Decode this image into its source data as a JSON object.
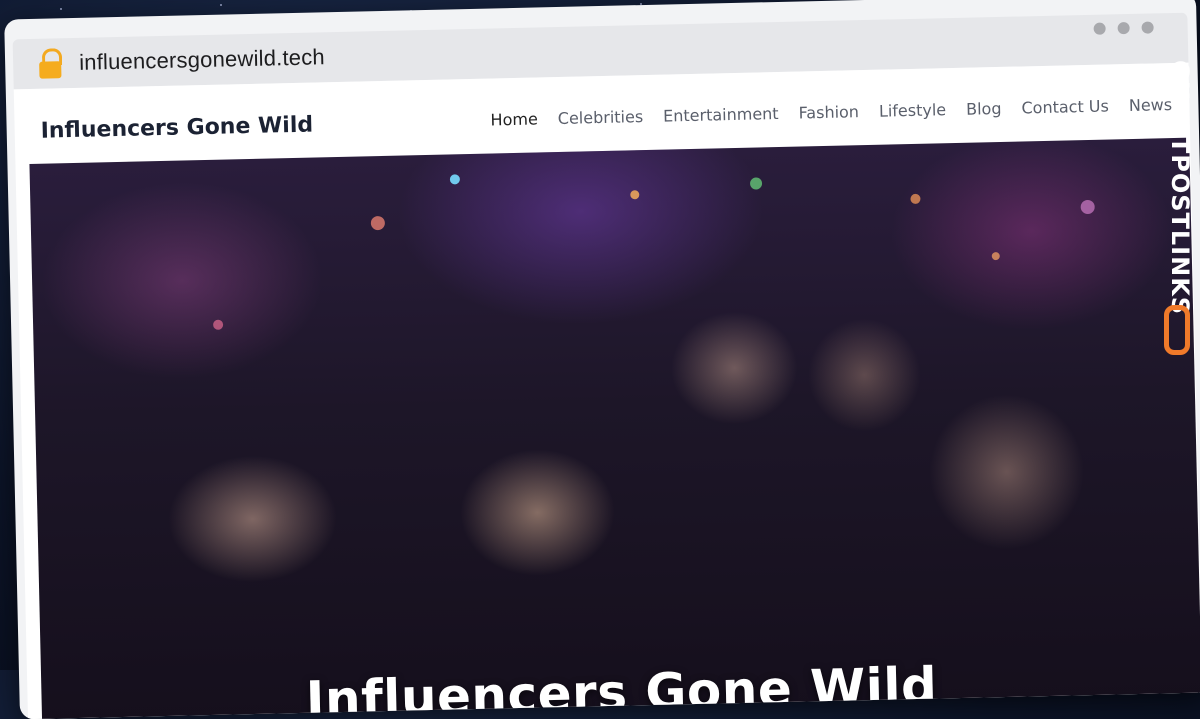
{
  "browser": {
    "url": "influencersgonewild.tech",
    "lock_icon": "lock-icon"
  },
  "site": {
    "title": "Influencers Gone Wild"
  },
  "nav": {
    "items": [
      {
        "label": "Home",
        "active": true
      },
      {
        "label": "Celebrities"
      },
      {
        "label": "Entertainment"
      },
      {
        "label": "Fashion"
      },
      {
        "label": "Lifestyle"
      },
      {
        "label": "Blog"
      },
      {
        "label": "Contact Us"
      },
      {
        "label": "News"
      }
    ]
  },
  "hero": {
    "title": "Influencers Gone Wild"
  },
  "watermark": {
    "text": "GUESTPOSTLINKS",
    "icon": "chain-link-icon",
    "color": "#f07a2a"
  }
}
